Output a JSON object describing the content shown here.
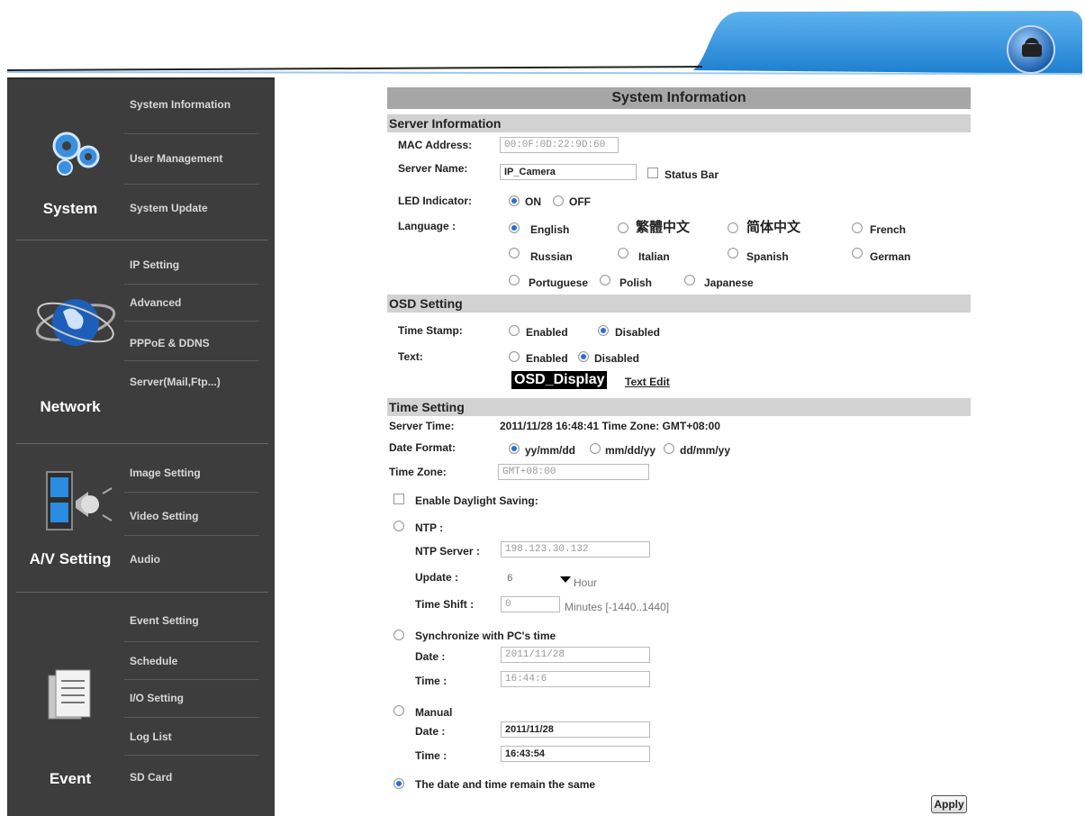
{
  "sidebar": {
    "sections": [
      {
        "label": "System",
        "items": [
          "System Information",
          "User Management",
          "System Update"
        ]
      },
      {
        "label": "Network",
        "items": [
          "IP Setting",
          "Advanced",
          "PPPoE & DDNS",
          "Server(Mail,Ftp...)"
        ]
      },
      {
        "label": "A/V Setting",
        "items": [
          "Image Setting",
          "Video Setting",
          "Audio"
        ]
      },
      {
        "label": "Event",
        "items": [
          "Event Setting",
          "Schedule",
          "I/O Setting",
          "Log List",
          "SD Card"
        ]
      }
    ]
  },
  "page_title": "System Information",
  "server_info": {
    "heading": "Server Information",
    "mac_label": "MAC Address:",
    "mac_value": "00:0F:0D:22:9D:60",
    "name_label": "Server Name:",
    "name_value": "IP_Camera",
    "status_bar_label": "Status Bar",
    "led_label": "LED Indicator:",
    "led_on": "ON",
    "led_off": "OFF",
    "language_label": "Language :",
    "languages": [
      "English",
      "繁體中文",
      "简体中文",
      "French",
      "Russian",
      "Italian",
      "Spanish",
      "German",
      "Portuguese",
      "Polish",
      "Japanese"
    ],
    "selected_language": "English"
  },
  "osd": {
    "heading": "OSD Setting",
    "timestamp_label": "Time Stamp:",
    "text_label": "Text:",
    "enabled": "Enabled",
    "disabled": "Disabled",
    "display_text": "OSD_Display",
    "text_edit": "Text Edit"
  },
  "time": {
    "heading": "Time Setting",
    "server_time_label": "Server Time:",
    "server_time_value": "2011/11/28 16:48:41 Time Zone: GMT+08:00",
    "date_format_label": "Date Format:",
    "formats": [
      "yy/mm/dd",
      "mm/dd/yy",
      "dd/mm/yy"
    ],
    "timezone_label": "Time Zone:",
    "timezone_value": "GMT+08:00",
    "dst_label": "Enable Daylight Saving:",
    "ntp_label": "NTP :",
    "ntp_server_label": "NTP Server :",
    "ntp_server_value": "198.123.30.132",
    "update_label": "Update :",
    "update_value": "6",
    "update_unit": "Hour",
    "shift_label": "Time Shift :",
    "shift_value": "0",
    "shift_unit": "Minutes  [-1440..1440]",
    "sync_label": "Synchronize with PC's time",
    "date_label": "Date :",
    "time_label": "Time :",
    "sync_date": "2011/11/28",
    "sync_time": "16:44:6",
    "manual_label": "Manual",
    "manual_date": "2011/11/28",
    "manual_time": "16:43:54",
    "same_label": "The date and time remain the same",
    "apply": "Apply"
  }
}
